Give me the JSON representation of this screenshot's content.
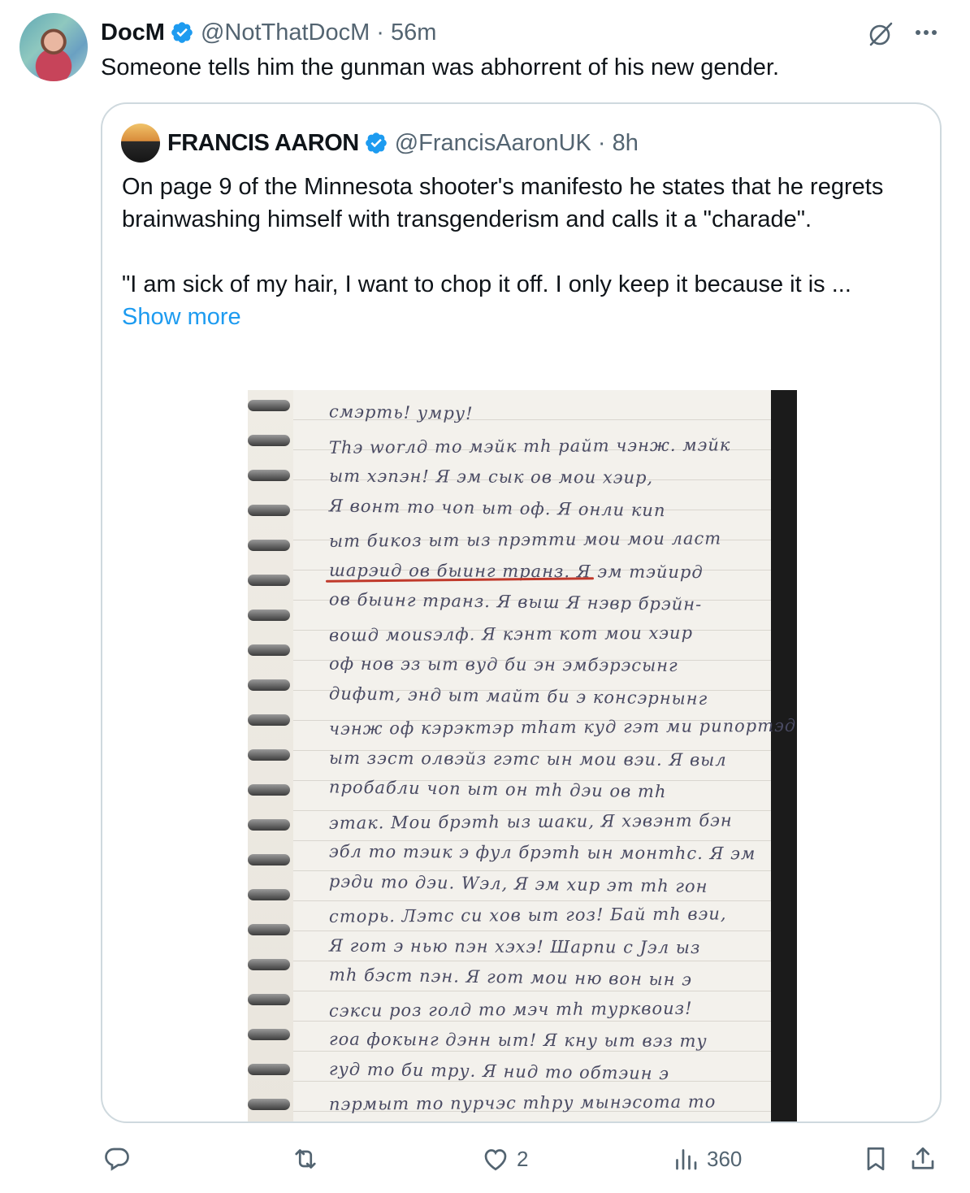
{
  "tweet": {
    "author": {
      "display_name": "DocM",
      "handle": "@NotThatDocM",
      "time": "56m",
      "verified": true
    },
    "text": "Someone tells him the gunman was abhorrent of his new gender."
  },
  "quote": {
    "author": {
      "display_name": "FRANCIS AARON",
      "handle": "@FrancisAaronUK",
      "time": "8h",
      "verified": true
    },
    "paragraph1": "On page 9 of the Minnesota shooter's manifesto he states that he regrets brainwashing himself with transgenderism and calls it a \"charade\".",
    "paragraph2": "\"I am sick of my hair, I want to chop it off. I only keep it because it is ...",
    "show_more": "Show more",
    "image_lines": [
      "смэрть!      умру!",
      "Тhэ worлд то мэйк тh райт чэнж. мэйк",
      "ыт хэпэн! Я эм сык ов мои хэир,",
      "Я вонт то чоп ыт оф. Я онли кип",
      "ыт бикоз ыт ыз прэтти мои мои ласт",
      "шарэид ов быинг транз. Я эм тэйирд",
      "ов быинг транз. Я выш Я нэвр брэйн-",
      "вошд моиsэлф. Я кэнт кот мои хэир",
      "оф нов эз ыт вуд би эн эмбэрэсынг",
      "дифит, энд ыт майт би э консэрнынг",
      "чэнж оф кэрэктэр тhат куд гэт ми рипортэд.",
      "ыт зэст олвэйз гэтс ын мои вэи. Я выл",
      "пробабли чоп ыт он тh дэи ов тh",
      "этак. Мои брэтh ыз шаки, Я хэвэнт бэн",
      "эбл то тэик э фул брэтh ын монтhс. Я эм",
      "рэди то дэи. Wэл, Я эм хир эт тh гон",
      "сторь. Лэтс си хов ыт гоз! Бай тh вэи,",
      "Я гот э нью пэн хэхэ! Шарпи с Jэл ыз",
      "тh бэст пэн. Я гот мои ню вон ын э",
      "сэкси роз голд то мэч тh турквоиз!",
      "гоа фокынг дэнн ыт! Я кну ыт вэз ту",
      "гуд то би тру. Я нид то обтэин э",
      "пэрмыт то пурчэс тhру мынэсота то"
    ]
  },
  "actions": {
    "replies": "",
    "reposts": "",
    "likes": "2",
    "views": "360"
  },
  "icons": [
    "verified-badge-icon",
    "grok-icon",
    "more-icon",
    "reply-icon",
    "repost-icon",
    "like-icon",
    "views-icon",
    "bookmark-icon",
    "share-icon"
  ],
  "colors": {
    "link": "#1d9bf0",
    "verified": "#1d9bf0",
    "secondary_text": "#536471",
    "underline": "#c0392b"
  }
}
